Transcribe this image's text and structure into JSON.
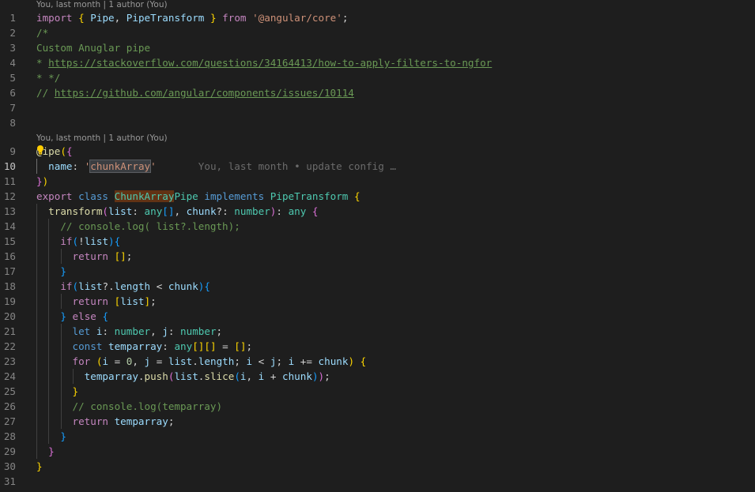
{
  "codelens": {
    "first": "You, last month | 1 author (You)",
    "second": "You, last month | 1 author (You)"
  },
  "ghost_blame": "You, last month • update config …",
  "icons": {
    "lightbulb": "lightbulb-icon"
  },
  "lines": {
    "l1": {
      "num": "1",
      "t1": "import",
      "t2": " ",
      "t3": "{",
      "t4": " ",
      "t5": "Pipe",
      "t6": ", ",
      "t7": "PipeTransform",
      "t8": " ",
      "t9": "}",
      "t10": " ",
      "t11": "from",
      "t12": " ",
      "t13": "'@angular/core'",
      "t14": ";"
    },
    "l2": {
      "num": "2",
      "t1": "/*"
    },
    "l3": {
      "num": "3",
      "t1": "Custom Anuglar pipe"
    },
    "l4": {
      "num": "4",
      "t1": "* ",
      "t2": "https://stackoverflow.com/questions/34164413/how-to-apply-filters-to-ngfor"
    },
    "l5": {
      "num": "5",
      "t1": "* */"
    },
    "l6": {
      "num": "6",
      "t1": "// ",
      "t2": "https://github.com/angular/components/issues/10114"
    },
    "l7": {
      "num": "7"
    },
    "l8": {
      "num": "8"
    },
    "l9": {
      "num": "9",
      "t1": "@",
      "t2": "ipe",
      "t3": "(",
      "t4": "{"
    },
    "l10": {
      "num": "10",
      "t1": "name",
      "t2": ": ",
      "t3": "'",
      "t4": "chunkArray",
      "t5": "'"
    },
    "l11": {
      "num": "11",
      "t1": "}",
      "t2": ")"
    },
    "l12": {
      "num": "12",
      "t1": "export",
      "t2": " ",
      "t3": "class",
      "t4": " ",
      "t5": "ChunkArray",
      "t6": "Pipe",
      "t7": " ",
      "t8": "implements",
      "t9": " ",
      "t10": "PipeTransform",
      "t11": " ",
      "t12": "{"
    },
    "l13": {
      "num": "13",
      "t1": "transform",
      "t2": "(",
      "t3": "list",
      "t4": ": ",
      "t5": "any",
      "t6": "[]",
      "t7": ", ",
      "t8": "chunk",
      "t9": "?: ",
      "t10": "number",
      "t11": ")",
      "t12": ": ",
      "t13": "any",
      "t14": " ",
      "t15": "{"
    },
    "l14": {
      "num": "14",
      "t1": "// console.log( list?.length);"
    },
    "l15": {
      "num": "15",
      "t1": "if",
      "t2": "(",
      "t3": "!",
      "t4": "list",
      "t5": ")",
      "t6": "{"
    },
    "l16": {
      "num": "16",
      "t1": "return",
      "t2": " ",
      "t3": "[]",
      "t4": ";"
    },
    "l17": {
      "num": "17",
      "t1": "}"
    },
    "l18": {
      "num": "18",
      "t1": "if",
      "t2": "(",
      "t3": "list",
      "t4": "?.",
      "t5": "length",
      "t6": " < ",
      "t7": "chunk",
      "t8": ")",
      "t9": "{"
    },
    "l19": {
      "num": "19",
      "t1": "return",
      "t2": " ",
      "t3": "[",
      "t4": "list",
      "t5": "]",
      "t6": ";"
    },
    "l20": {
      "num": "20",
      "t1": "}",
      "t2": " ",
      "t3": "else",
      "t4": " ",
      "t5": "{"
    },
    "l21": {
      "num": "21",
      "t1": "let",
      "t2": " ",
      "t3": "i",
      "t4": ": ",
      "t5": "number",
      "t6": ", ",
      "t7": "j",
      "t8": ": ",
      "t9": "number",
      "t10": ";"
    },
    "l22": {
      "num": "22",
      "t1": "const",
      "t2": " ",
      "t3": "temparray",
      "t4": ": ",
      "t5": "any",
      "t6": "[]",
      "t7": "[]",
      "t8": " = ",
      "t9": "[]",
      "t10": ";"
    },
    "l23": {
      "num": "23",
      "t1": "for",
      "t2": " ",
      "t3": "(",
      "t4": "i",
      "t5": " = ",
      "t6": "0",
      "t7": ", ",
      "t8": "j",
      "t9": " = ",
      "t10": "list",
      "t11": ".",
      "t12": "length",
      "t13": "; ",
      "t14": "i",
      "t15": " < ",
      "t16": "j",
      "t17": "; ",
      "t18": "i",
      "t19": " += ",
      "t20": "chunk",
      "t21": ")",
      "t22": " ",
      "t23": "{"
    },
    "l24": {
      "num": "24",
      "t1": "temparray",
      "t2": ".",
      "t3": "push",
      "t4": "(",
      "t5": "list",
      "t6": ".",
      "t7": "slice",
      "t8": "(",
      "t9": "i",
      "t10": ", ",
      "t11": "i",
      "t12": " + ",
      "t13": "chunk",
      "t14": ")",
      "t15": ")",
      "t16": ";"
    },
    "l25": {
      "num": "25",
      "t1": "}"
    },
    "l26": {
      "num": "26",
      "t1": "// console.log(temparray)"
    },
    "l27": {
      "num": "27",
      "t1": "return",
      "t2": " ",
      "t3": "temparray",
      "t4": ";"
    },
    "l28": {
      "num": "28",
      "t1": "}"
    },
    "l29": {
      "num": "29",
      "t1": "}"
    },
    "l30": {
      "num": "30",
      "t1": "}"
    },
    "l31": {
      "num": "31"
    }
  }
}
